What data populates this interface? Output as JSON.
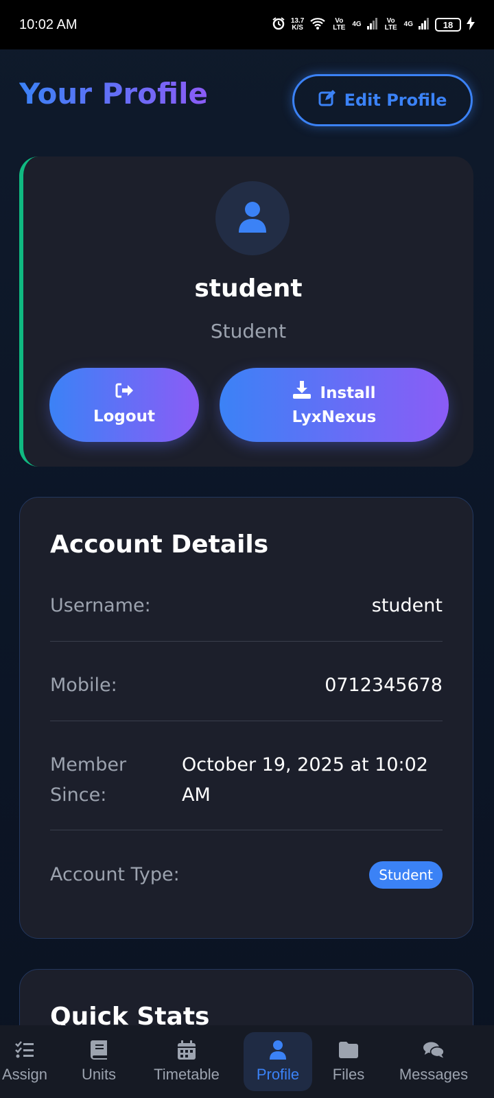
{
  "status_bar": {
    "time": "10:02 AM",
    "net_speed": "13.7",
    "net_unit": "K/S",
    "volte1": "Vo LTE",
    "volte2": "Vo LTE",
    "signal1": "4G",
    "signal2": "4G",
    "battery": "18"
  },
  "header": {
    "title": "Your Profile",
    "edit_label": "Edit Profile"
  },
  "profile": {
    "name": "student",
    "role": "Student",
    "logout_label": "Logout",
    "install_label_line1": "Install",
    "install_label_line2": "LyxNexus"
  },
  "account_details": {
    "title": "Account Details",
    "rows": [
      {
        "label": "Username:",
        "value": "student"
      },
      {
        "label": "Mobile:",
        "value": "0712345678"
      },
      {
        "label_line1": "Member",
        "label_line2": "Since:",
        "value_line1": "October 19, 2025 at 10:02",
        "value_line2": "AM"
      },
      {
        "label": "Account Type:",
        "value": "Student"
      }
    ]
  },
  "quick_stats": {
    "title": "Quick Stats"
  },
  "nav": {
    "items": [
      {
        "label": "Assign",
        "icon": "tasks-icon"
      },
      {
        "label": "Units",
        "icon": "book-icon"
      },
      {
        "label": "Timetable",
        "icon": "calendar-icon"
      },
      {
        "label": "Profile",
        "icon": "user-icon",
        "active": true
      },
      {
        "label": "Files",
        "icon": "folder-icon"
      },
      {
        "label": "Messages",
        "icon": "chat-icon"
      }
    ]
  },
  "colors": {
    "accent": "#3b82f6",
    "accent2": "#8b5cf6",
    "card_stripe": "#10b981"
  }
}
